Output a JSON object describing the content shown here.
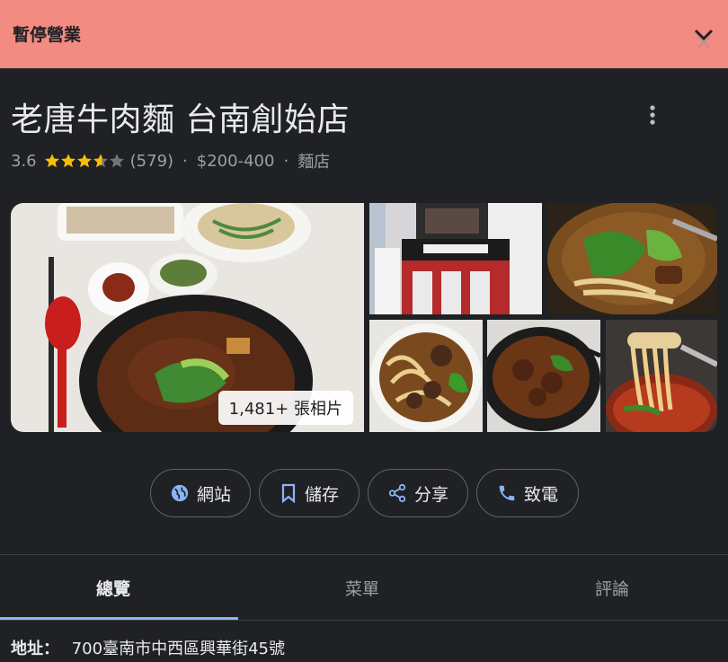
{
  "banner": {
    "text": "暫停營業",
    "close_icon": "close-icon"
  },
  "place": {
    "name": "老唐牛肉麵 台南創始店",
    "rating": "3.6",
    "rating_value": 3.6,
    "review_count": "(579)",
    "price_range": "$200-400",
    "category": "麵店",
    "sep": "·"
  },
  "photos": {
    "count_label": "1,481+ 張相片"
  },
  "actions": {
    "website": "網站",
    "save": "儲存",
    "share": "分享",
    "call": "致電"
  },
  "tabs": {
    "overview": "總覽",
    "menu": "菜單",
    "reviews": "評論"
  },
  "address": {
    "label": "地址：",
    "value": "700臺南市中西區興華街45號"
  },
  "colors": {
    "banner": "#f28b82",
    "background": "#202124",
    "star": "#fbbc04",
    "accent": "#8ab4f8"
  }
}
